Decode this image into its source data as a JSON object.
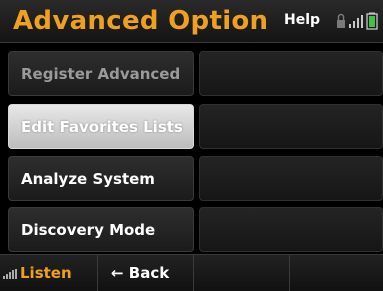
{
  "header": {
    "title": "Advanced Option",
    "help_label": "Help",
    "status_icons": [
      "lock-icon",
      "signal-bars-icon",
      "battery-icon"
    ]
  },
  "menu": {
    "items": [
      {
        "label": "Register Advanced",
        "state": "disabled"
      },
      {
        "label": "Edit Favorites Lists",
        "state": "selected"
      },
      {
        "label": "Analyze System",
        "state": "normal"
      },
      {
        "label": "Discovery Mode",
        "state": "normal"
      }
    ]
  },
  "footer": {
    "listen_label": "Listen",
    "back_label": "← Back"
  },
  "colors": {
    "accent": "#f0a020",
    "background": "#000000",
    "button": "#252525",
    "selected": "#d0d0d0"
  }
}
